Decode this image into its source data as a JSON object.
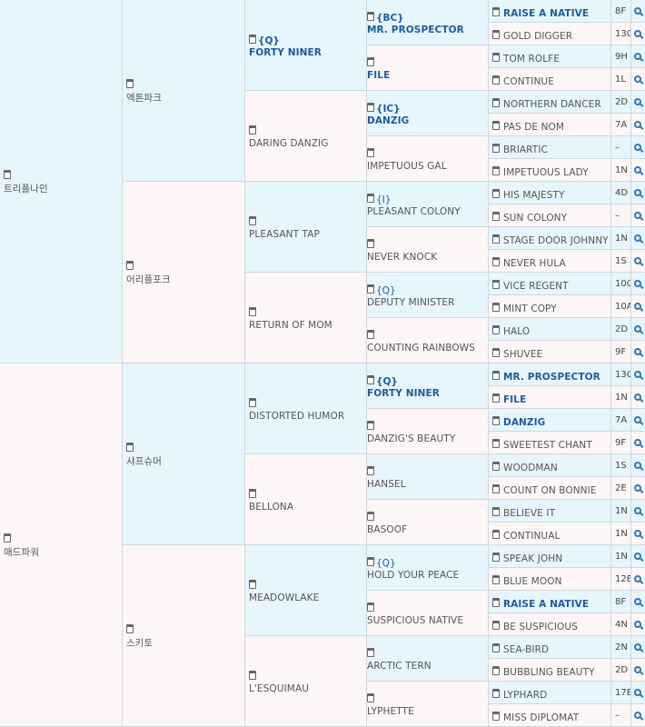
{
  "pedigree": {
    "g1": [
      {
        "name": "트리플나인"
      },
      {
        "name": "매드파워"
      }
    ],
    "g2": [
      {
        "name": "엑톤파크"
      },
      {
        "name": "어리플포크"
      },
      {
        "name": "샤프슈머"
      },
      {
        "name": "스키토"
      }
    ],
    "g3": [
      {
        "tag": "{Q}",
        "name": "FORTY NINER",
        "bold": true
      },
      {
        "name": "DARING DANZIG"
      },
      {
        "name": "PLEASANT TAP"
      },
      {
        "name": "RETURN OF MOM"
      },
      {
        "name": "DISTORTED HUMOR"
      },
      {
        "name": "BELLONA"
      },
      {
        "name": "MEADOWLAKE"
      },
      {
        "name": "L'ESQUIMAU"
      }
    ],
    "g4": [
      {
        "tag": "{BC}",
        "name": "MR. PROSPECTOR",
        "bold": true
      },
      {
        "name": "FILE",
        "bold": true
      },
      {
        "tag": "{IC}",
        "name": "DANZIG",
        "bold": true
      },
      {
        "name": "IMPETUOUS GAL"
      },
      {
        "tag": "{I}",
        "name": "PLEASANT COLONY"
      },
      {
        "name": "NEVER KNOCK"
      },
      {
        "tag": "{Q}",
        "name": "DEPUTY MINISTER"
      },
      {
        "name": "COUNTING RAINBOWS"
      },
      {
        "tag": "{Q}",
        "name": "FORTY NINER",
        "bold": true
      },
      {
        "name": "DANZIG'S BEAUTY"
      },
      {
        "name": "HANSEL"
      },
      {
        "name": "BASOOF"
      },
      {
        "tag": "{Q}",
        "name": "HOLD YOUR PEACE"
      },
      {
        "name": "SUSPICIOUS NATIVE"
      },
      {
        "name": "ARCTIC TERN"
      },
      {
        "name": "LYPHETTE"
      }
    ],
    "g5": [
      {
        "name": "RAISE A NATIVE",
        "bold": true,
        "code": "8F"
      },
      {
        "name": "GOLD DIGGER",
        "code": "13C"
      },
      {
        "name": "TOM ROLFE",
        "code": "9H"
      },
      {
        "name": "CONTINUE",
        "code": "1L"
      },
      {
        "name": "NORTHERN DANCER",
        "code": "2D"
      },
      {
        "name": "PAS DE NOM",
        "code": "7A"
      },
      {
        "name": "BRIARTIC",
        "code": "–"
      },
      {
        "name": "IMPETUOUS LADY",
        "code": "1N"
      },
      {
        "name": "HIS MAJESTY",
        "code": "4D"
      },
      {
        "name": "SUN COLONY",
        "code": "–"
      },
      {
        "name": "STAGE DOOR JOHNNY",
        "code": "1N"
      },
      {
        "name": "NEVER HULA",
        "code": "1S"
      },
      {
        "name": "VICE REGENT",
        "code": "10C"
      },
      {
        "name": "MINT COPY",
        "code": "10A"
      },
      {
        "name": "HALO",
        "code": "2D"
      },
      {
        "name": "SHUVEE",
        "code": "9F"
      },
      {
        "name": "MR. PROSPECTOR",
        "bold": true,
        "code": "13C"
      },
      {
        "name": "FILE",
        "bold": true,
        "code": "1N"
      },
      {
        "name": "DANZIG",
        "bold": true,
        "code": "7A"
      },
      {
        "name": "SWEETEST CHANT",
        "code": "9F"
      },
      {
        "name": "WOODMAN",
        "code": "1S"
      },
      {
        "name": "COUNT ON BONNIE",
        "code": "2E"
      },
      {
        "name": "BELIEVE IT",
        "code": "1N"
      },
      {
        "name": "CONTINUAL",
        "code": "1N"
      },
      {
        "name": "SPEAK JOHN",
        "code": "1N"
      },
      {
        "name": "BLUE MOON",
        "code": "12E"
      },
      {
        "name": "RAISE A NATIVE",
        "bold": true,
        "code": "8F"
      },
      {
        "name": "BE SUSPICIOUS",
        "code": "4N"
      },
      {
        "name": "SEA-BIRD",
        "code": "2N"
      },
      {
        "name": "BUBBLING BEAUTY",
        "code": "2D"
      },
      {
        "name": "LYPHARD",
        "code": "17B"
      },
      {
        "name": "MISS DIPLOMAT",
        "code": "–"
      }
    ]
  },
  "icons": {
    "detail": "document-icon",
    "search": "magnifier-icon"
  },
  "colors": {
    "male_bg": "#e7f5fd",
    "female_bg": "#fdf6f6",
    "link": "#1e5b9c",
    "border": "#cfd8de"
  }
}
